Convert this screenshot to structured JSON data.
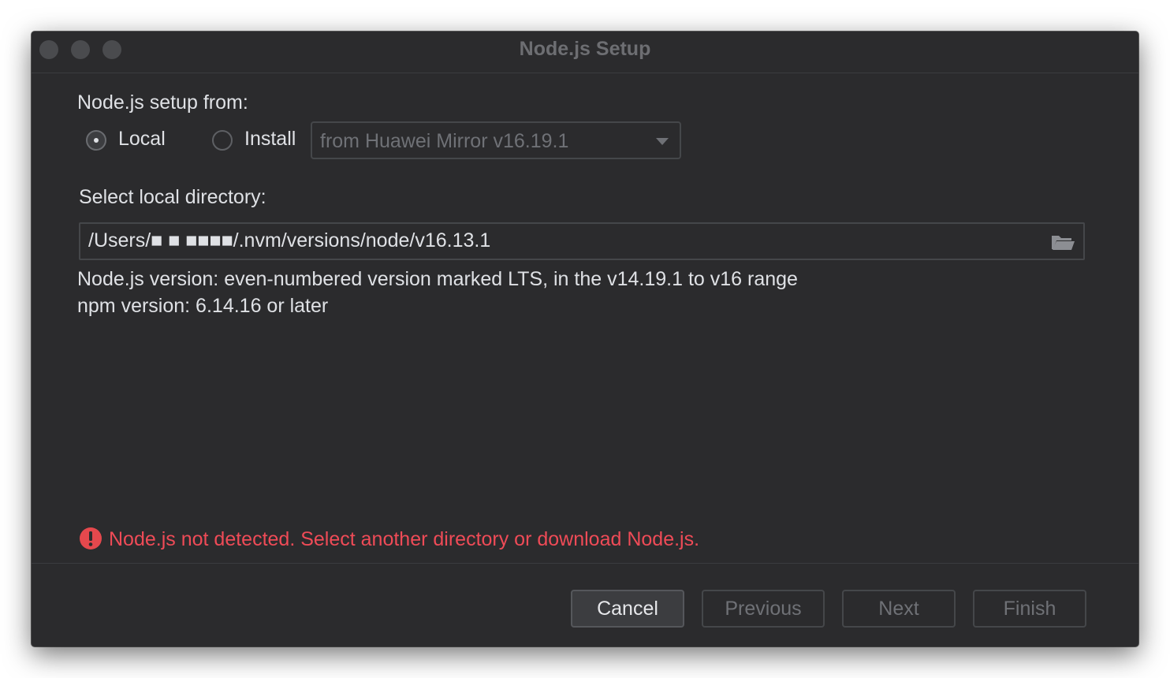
{
  "window": {
    "title": "Node.js Setup"
  },
  "setup_from": {
    "label": "Node.js setup from:",
    "options": [
      {
        "label": "Local",
        "checked": true
      },
      {
        "label": "Install",
        "checked": false
      }
    ],
    "install_source": {
      "selected": "from Huawei Mirror v16.19.1"
    }
  },
  "local_directory": {
    "label": "Select local directory:",
    "value": "/Users/■  ■ ■■■■/.nvm/versions/node/v16.13.1",
    "icon": "folder-open-icon"
  },
  "requirements": {
    "node_version": "Node.js version: even-numbered version marked LTS, in the v14.19.1 to v16 range",
    "npm_version": "npm version: 6.14.16 or later"
  },
  "error": {
    "icon": "error-icon",
    "message": "Node.js not detected. Select another directory or download Node.js.",
    "color": "#ef4b57"
  },
  "buttons": {
    "cancel": "Cancel",
    "previous": "Previous",
    "next": "Next",
    "finish": "Finish"
  },
  "colors": {
    "background": "#2b2b2d",
    "text": "#dfe1e5",
    "disabled_text": "#6f7176",
    "error": "#ef4b57"
  }
}
